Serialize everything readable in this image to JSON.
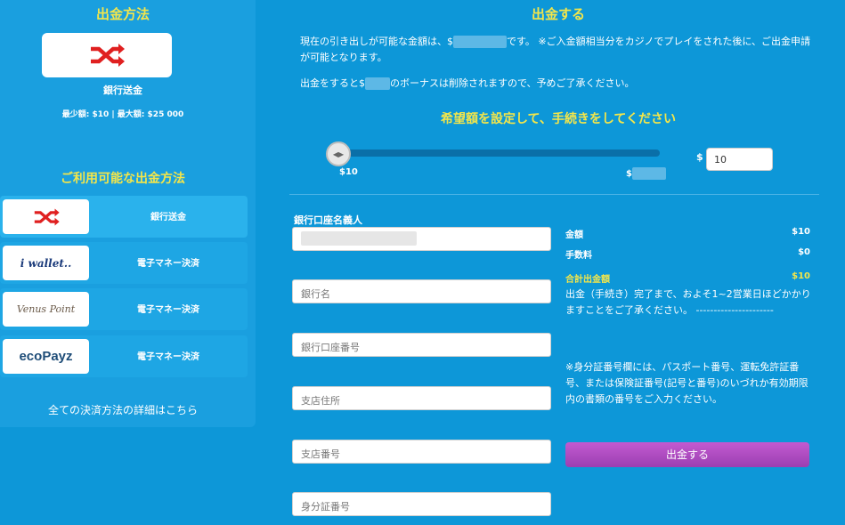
{
  "left": {
    "title": "出金方法",
    "selected_method": "銀行送金",
    "limits": "最少額: $10 | 最大額: $25 000",
    "available_title": "ご利用可能な出金方法",
    "methods": [
      {
        "logo": "shuffle-icon",
        "name": "銀行送金"
      },
      {
        "logo_text": "i wallet..",
        "name": "電子マネー決済"
      },
      {
        "logo_text": "Venus Point",
        "name": "電子マネー決済"
      },
      {
        "logo_text": "ecoPayz",
        "name": "電子マネー決済"
      }
    ],
    "all_methods_link": "全ての決済方法の詳細はこちら"
  },
  "main": {
    "title": "出金する",
    "info_line1_a": "現在の引き出しが可能な金額は、$",
    "info_line1_b": "です。 ※ご入金額相当分をカジノでプレイをされた後に、ご出金申請が可能となります。",
    "info_line2_a": "出金をすると$",
    "info_line2_b": "のボーナスは削除されますので、予めご了承ください。",
    "set_title": "希望額を設定して、手続きをしてください",
    "slider_min": "$10",
    "slider_max_prefix": "$",
    "slider_value_fraction": 0,
    "amount_currency": "$",
    "amount_value": "10"
  },
  "form": {
    "account_holder_label": "銀行口座名義人",
    "bank_name_placeholder": "銀行名",
    "account_number_placeholder": "銀行口座番号",
    "branch_address_placeholder": "支店住所",
    "branch_number_placeholder": "支店番号",
    "id_number_placeholder": "身分証番号"
  },
  "summary": {
    "amount_label": "金額",
    "amount_value": "$10",
    "fee_label": "手数料",
    "fee_value": "$0",
    "total_label": "合計出金額",
    "total_value": "$10",
    "note1": "出金（手続き）完了まで、およそ1~2営業日ほどかかりますことをご了承ください。 ----------------------",
    "note2": "※身分証番号欄には、パスポート番号、運転免許証番号、または保険証番号(記号と番号)のいづれか有効期限内の書類の番号をご入力ください。",
    "submit_label": "出金する"
  },
  "colors": {
    "background": "#0d97d8",
    "heading": "#f4e64a",
    "submit": "#b04cc4",
    "shuffle_icon": "#e02020"
  }
}
